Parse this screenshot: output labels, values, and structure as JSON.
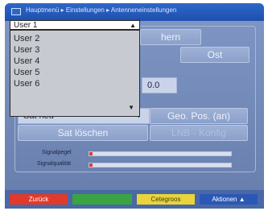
{
  "header": {
    "breadcrumb": "Hauptmenü ▸ Einstellungen ▸ Antenneneinstellungen"
  },
  "dropdown": {
    "selected": "User 1",
    "caret": "▲",
    "options": [
      "User 2",
      "User 3",
      "User 4",
      "User 5",
      "User 6"
    ],
    "list_caret": "▼"
  },
  "main": {
    "button_west_partial": "hern",
    "button_ost": "Ost",
    "value_field": "0.0",
    "sat_field": "Sat neu",
    "sat_field_arrow": "◄",
    "geo_button": "Geo. Pos. (an)",
    "sat_delete_button": "Sat löschen",
    "lnb_button": "LNB - Konfig",
    "signal_strength_label": "Signalpegel",
    "signal_quality_label": "Signalqualität",
    "signal_strength": 0.02,
    "signal_quality": 0.02
  },
  "footer": {
    "red": "Zurück",
    "green": "",
    "yellow": "Cetegroos",
    "blue": "Aktionen ▲"
  },
  "colors": {
    "red": "#e03a2c",
    "green": "#3aa442",
    "yellow": "#e9d43a",
    "blue": "#2b58b6"
  }
}
